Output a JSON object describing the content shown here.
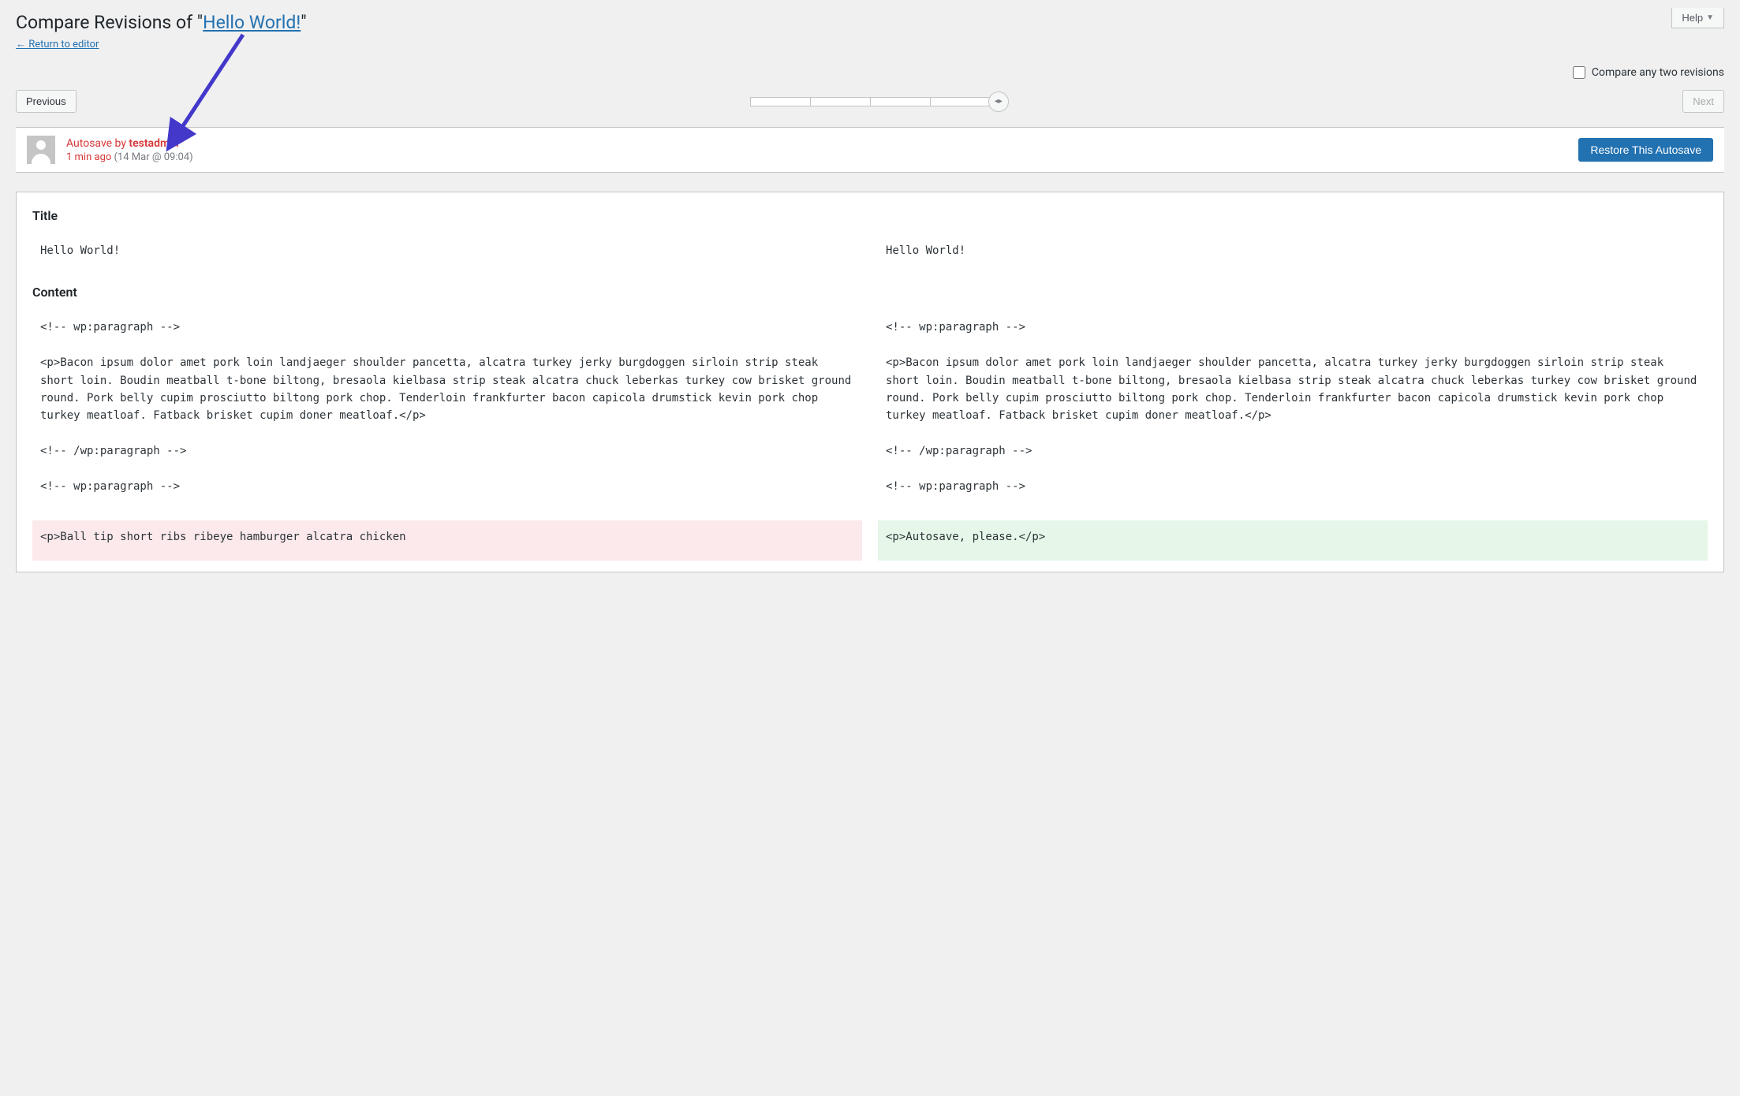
{
  "help_label": "Help",
  "heading_prefix": "Compare Revisions of \"",
  "heading_link": "Hello World!",
  "heading_suffix": "\"",
  "return_link": "← Return to editor",
  "compare_label": "Compare any two revisions",
  "prev_btn": "Previous",
  "next_btn": "Next",
  "meta": {
    "autosave_by": "Autosave by ",
    "user": "testadmin",
    "ago": "1 min ago ",
    "paren": "(14 Mar @ 09:04)",
    "restore_btn": "Restore This Autosave"
  },
  "diff": {
    "title_heading": "Title",
    "content_heading": "Content",
    "title_left": "Hello World!",
    "title_right": "Hello World!",
    "content_left_block1": "<!-- wp:paragraph -->\n\n<p>Bacon ipsum dolor amet pork loin landjaeger shoulder pancetta, alcatra turkey jerky burgdoggen sirloin strip steak short loin. Boudin meatball t-bone biltong, bresaola kielbasa strip steak alcatra chuck leberkas turkey cow brisket ground round. Pork belly cupim prosciutto biltong pork chop. Tenderloin frankfurter bacon capicola drumstick kevin pork chop turkey meatloaf. Fatback brisket cupim doner meatloaf.</p>\n\n<!-- /wp:paragraph -->\n\n<!-- wp:paragraph -->",
    "content_right_block1": "<!-- wp:paragraph -->\n\n<p>Bacon ipsum dolor amet pork loin landjaeger shoulder pancetta, alcatra turkey jerky burgdoggen sirloin strip steak short loin. Boudin meatball t-bone biltong, bresaola kielbasa strip steak alcatra chuck leberkas turkey cow brisket ground round. Pork belly cupim prosciutto biltong pork chop. Tenderloin frankfurter bacon capicola drumstick kevin pork chop turkey meatloaf. Fatback brisket cupim doner meatloaf.</p>\n\n<!-- /wp:paragraph -->\n\n<!-- wp:paragraph -->",
    "content_left_removed": "<p>Ball tip short ribs ribeye hamburger alcatra chicken",
    "content_right_added": "<p>Autosave, please.</p>"
  }
}
